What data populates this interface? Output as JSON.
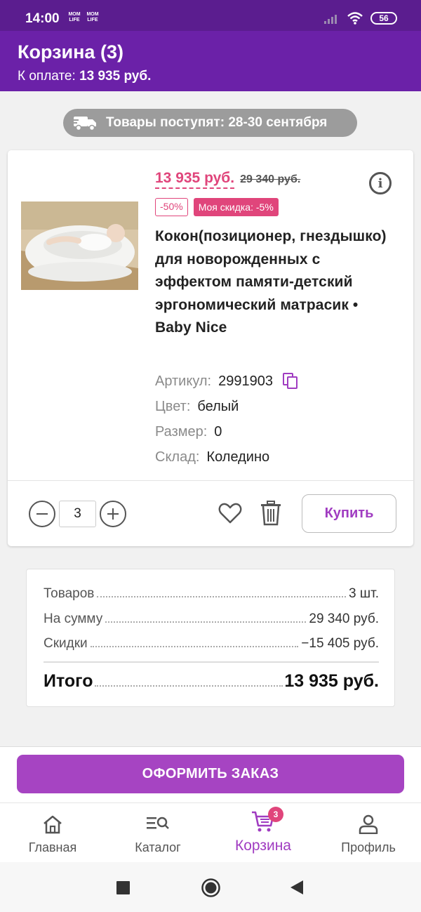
{
  "status_bar": {
    "time": "14:00",
    "logo_text": "MOM LIFE",
    "battery": "56"
  },
  "header": {
    "title": "Корзина (3)",
    "to_pay_label": "К оплате:",
    "to_pay_value": "13 935 руб."
  },
  "delivery_banner": {
    "icon": "truck-icon",
    "text": "Товары поступят: 28-30 сентября"
  },
  "product": {
    "price": "13 935 руб.",
    "old_price": "29 340 руб.",
    "discount_badge": "-50%",
    "my_discount_badge": "Моя скидка: -5%",
    "title": "Кокон(позиционер, гнездышко) для новорожденных с эффектом памяти-детский эргономический матрасик • Baby Nice",
    "specs": [
      {
        "label": "Артикул:",
        "value": "2991903"
      },
      {
        "label": "Цвет:",
        "value": "белый"
      },
      {
        "label": "Размер:",
        "value": "0"
      },
      {
        "label": "Склад:",
        "value": "Коледино"
      }
    ],
    "quantity": "3",
    "buy_label": "Купить"
  },
  "summary": {
    "rows": [
      {
        "label": "Товаров",
        "value": "3 шт."
      },
      {
        "label": "На сумму",
        "value": "29 340 руб."
      },
      {
        "label": "Скидки",
        "value": "−15 405 руб."
      }
    ],
    "total_label": "Итого",
    "total_value": "13 935 руб."
  },
  "checkout_label": "ОФОРМИТЬ ЗАКАЗ",
  "bottom_nav": {
    "items": [
      {
        "label": "Главная",
        "icon": "home-icon"
      },
      {
        "label": "Каталог",
        "icon": "catalog-search-icon"
      },
      {
        "label": "Корзина",
        "icon": "cart-icon",
        "badge": "3"
      },
      {
        "label": "Профиль",
        "icon": "profile-icon"
      }
    ],
    "active_index": 2
  },
  "colors": {
    "status_bar": "#5b1d8f",
    "header": "#6b21a8",
    "accent_pink": "#e0457b",
    "accent_purple": "#a644c2"
  }
}
